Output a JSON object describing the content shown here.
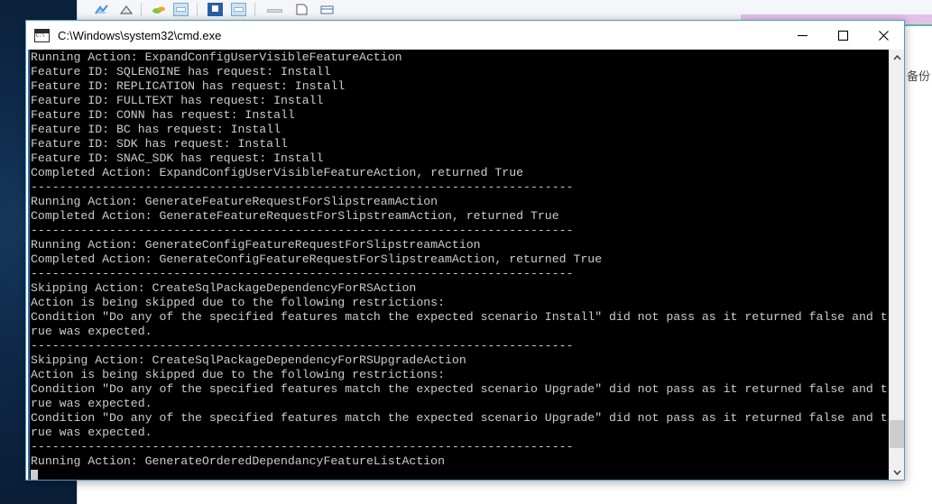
{
  "desktop": {
    "background_color": "#0d2745",
    "bg_app": {
      "cjk_label": "备份",
      "toolbar_icons": [
        "chart-icon",
        "trend-icon",
        "divider",
        "palette-icon",
        "window-icon",
        "divider",
        "blue-square-icon",
        "window2-icon",
        "divider",
        "bar-icon",
        "page-icon",
        "table-icon"
      ],
      "row2_icons": [
        "page-small-icon",
        "folder-yellow-icon",
        "divider"
      ],
      "highlight_color": "#e3c3ea",
      "accent_line_color": "#5fb8a8"
    }
  },
  "cmd_window": {
    "title": "C:\\Windows\\system32\\cmd.exe",
    "icon": "cmd-prompt-icon",
    "border_color": "#4b9ccd",
    "controls": {
      "minimize_label": "Minimize",
      "maximize_label": "Maximize",
      "close_label": "Close"
    },
    "console": {
      "background_color": "#000000",
      "foreground_color": "#cccccc",
      "separator": "----------------------------------------------------------------------------",
      "lines": [
        "Running Action: ExpandConfigUserVisibleFeatureAction",
        "Feature ID: SQLENGINE has request: Install",
        "Feature ID: REPLICATION has request: Install",
        "Feature ID: FULLTEXT has request: Install",
        "Feature ID: CONN has request: Install",
        "Feature ID: BC has request: Install",
        "Feature ID: SDK has request: Install",
        "Feature ID: SNAC_SDK has request: Install",
        "Completed Action: ExpandConfigUserVisibleFeatureAction, returned True",
        "----------------------------------------------------------------------------",
        "Running Action: GenerateFeatureRequestForSlipstreamAction",
        "Completed Action: GenerateFeatureRequestForSlipstreamAction, returned True",
        "----------------------------------------------------------------------------",
        "Running Action: GenerateConfigFeatureRequestForSlipstreamAction",
        "Completed Action: GenerateConfigFeatureRequestForSlipstreamAction, returned True",
        "----------------------------------------------------------------------------",
        "Skipping Action: CreateSqlPackageDependencyForRSAction",
        "Action is being skipped due to the following restrictions:",
        "Condition \"Do any of the specified features match the expected scenario Install\" did not pass as it returned false and t",
        "rue was expected.",
        "----------------------------------------------------------------------------",
        "Skipping Action: CreateSqlPackageDependencyForRSUpgradeAction",
        "Action is being skipped due to the following restrictions:",
        "Condition \"Do any of the specified features match the expected scenario Upgrade\" did not pass as it returned false and t",
        "rue was expected.",
        "Condition \"Do any of the specified features match the expected scenario Upgrade\" did not pass as it returned false and t",
        "rue was expected.",
        "----------------------------------------------------------------------------",
        "Running Action: GenerateOrderedDependancyFeatureListAction"
      ],
      "cursor_visible": true
    },
    "scrollbar": {
      "up_arrow": "chevron-up-icon",
      "down_arrow": "chevron-down-icon",
      "thumb_color": "#cdcdcd",
      "thumb_top_pct": 89,
      "thumb_height_pct": 7
    }
  }
}
